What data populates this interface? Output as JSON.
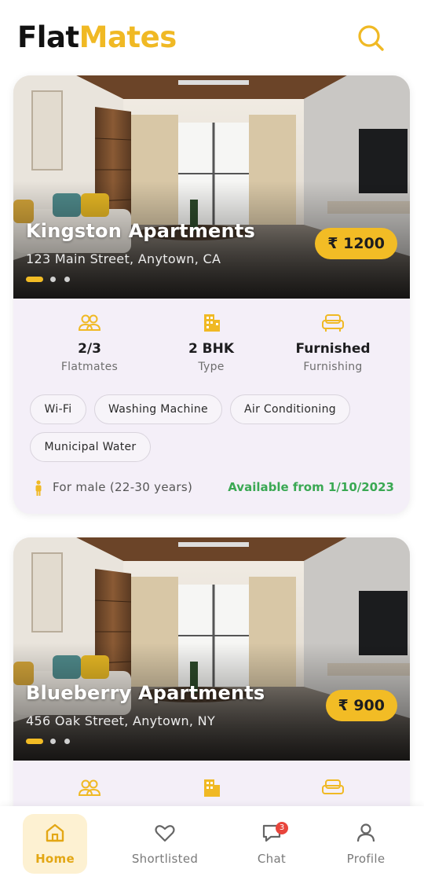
{
  "header": {
    "logo_part1": "Flat",
    "logo_part2": "Mates"
  },
  "colors": {
    "accent": "#f2bc25",
    "available": "#3aa853",
    "card_bg": "#f4eff8",
    "nav_active_bg": "#fdf1d2"
  },
  "listings": [
    {
      "name": "Kingston Apartments",
      "address": "123 Main Street, Anytown, CA",
      "price": "₹ 1200",
      "flatmates_value": "2/3",
      "flatmates_label": "Flatmates",
      "type_value": "2 BHK",
      "type_label": "Type",
      "furnishing_value": "Furnished",
      "furnishing_label": "Furnishing",
      "amenities": [
        "Wi-Fi",
        "Washing Machine",
        "Air Conditioning",
        "Municipal Water"
      ],
      "preference": "For male (22-30 years)",
      "availability": "Available from 1/10/2023"
    },
    {
      "name": "Blueberry Apartments",
      "address": "456 Oak Street, Anytown, NY",
      "price": "₹ 900"
    }
  ],
  "nav": {
    "items": [
      {
        "label": "Home",
        "icon": "home-icon",
        "active": true
      },
      {
        "label": "Shortlisted",
        "icon": "heart-icon"
      },
      {
        "label": "Chat",
        "icon": "chat-icon",
        "badge": "3"
      },
      {
        "label": "Profile",
        "icon": "profile-icon"
      }
    ]
  }
}
